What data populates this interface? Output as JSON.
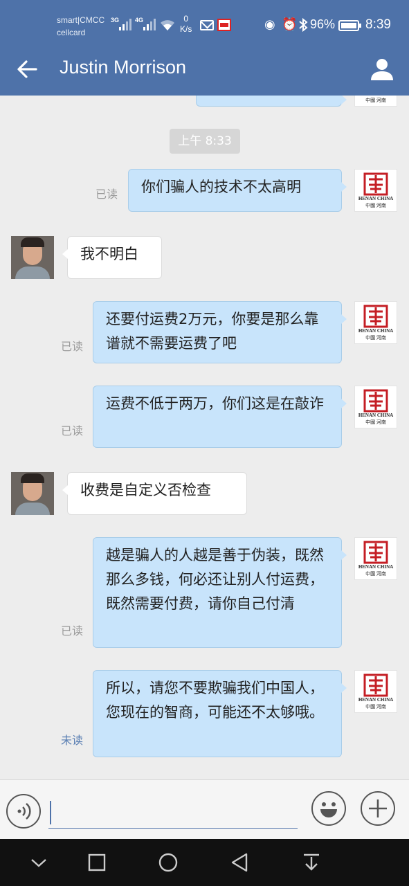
{
  "status_bar": {
    "carrier_line1": "smart|CMCC",
    "carrier_line2": "cellcard",
    "net1": "3G",
    "net2": "4G",
    "speed_value": "0",
    "speed_unit": "K/s",
    "battery_percent": "96%",
    "time": "8:39"
  },
  "header": {
    "contact_name": "Justin Morrison"
  },
  "chat": {
    "time_divider": "上午 8:33",
    "messages": [
      {
        "from": "me",
        "status": "已读",
        "text": "你们骗人的技术不太高明"
      },
      {
        "from": "them",
        "text": "我不明白"
      },
      {
        "from": "me",
        "status": "已读",
        "text": "还要付运费2万元，你要是那么靠谱就不需要运费了吧"
      },
      {
        "from": "me",
        "status": "已读",
        "text": "运费不低于两万，你们这是在敲诈"
      },
      {
        "from": "them",
        "text": "收费是自定义否检查"
      },
      {
        "from": "me",
        "status": "已读",
        "text": "越是骗人的人越是善于伪装，既然那么多钱，何必还让别人付运费，既然需要付费，请你自己付清"
      },
      {
        "from": "me",
        "status": "未读",
        "text": "所以，请您不要欺骗我们中国人，您现在的智商，可能还不太够哦。"
      }
    ]
  },
  "my_avatar": {
    "logo_line1": "HENAN CHINA",
    "logo_line2": "中國 河南"
  },
  "input": {
    "value": ""
  },
  "icons": {
    "back": "arrow-left-icon",
    "profile": "person-icon",
    "voice": "voice-icon",
    "emoji": "emoji-icon",
    "plus": "plus-icon"
  },
  "colors": {
    "header": "#4e72a9",
    "my_bubble": "#c8e4fb",
    "their_bubble": "#ffffff",
    "chat_bg": "#ededed",
    "unread": "#5a7fb3"
  }
}
